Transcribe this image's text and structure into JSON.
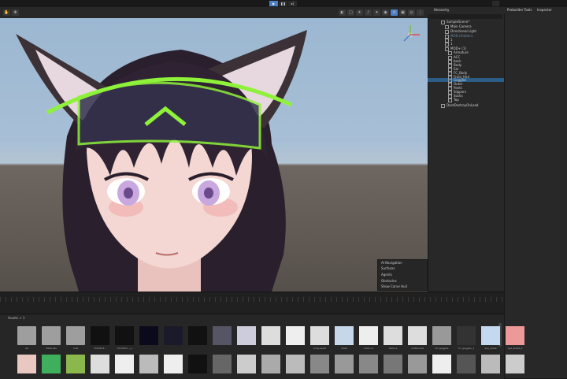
{
  "hierarchy": {
    "tab_label": "Hierarchy",
    "items": [
      {
        "label": "SampleScene*"
      },
      {
        "label": "Main Camera"
      },
      {
        "label": "Directional Light"
      },
      {
        "label": "MOD (Hidden)"
      },
      {
        "label": "1"
      },
      {
        "label": "1"
      },
      {
        "label": "MOD+ (1)"
      },
      {
        "label": "Armature"
      },
      {
        "label": "ACC"
      },
      {
        "label": "back"
      },
      {
        "label": "Body"
      },
      {
        "label": "Ear"
      },
      {
        "label": "FC_Body"
      },
      {
        "label": "Front_Hair"
      },
      {
        "label": "Goggles"
      },
      {
        "label": "Outer"
      },
      {
        "label": "Pants"
      },
      {
        "label": "Slippers"
      },
      {
        "label": "Socks"
      },
      {
        "label": "Top"
      },
      {
        "label": "DontDestroyOnLoad"
      }
    ]
  },
  "inspector": {
    "tabs": [
      "Probuilder Tools",
      "Inspector"
    ]
  },
  "navigation_overlay": {
    "title": "AI Navigation",
    "rows": [
      "Surfaces",
      "Agents",
      "Obstacles",
      "Show Carve Hull"
    ]
  },
  "project": {
    "breadcrumb": "Assets > 1",
    "row1": [
      "all",
      "Materials",
      "mat",
      "7012023...",
      "7012023..._s",
      "",
      "",
      "",
      "",
      "",
      "",
      "",
      "body.asset",
      "mask",
      "mask.uv",
      "texture",
      "uvTextures",
      "for goggles",
      "for goggles_1",
      "eye_sheet",
      "eye_sheet_2"
    ],
    "row2": [
      "",
      "",
      "",
      "",
      "",
      "",
      "",
      "",
      "",
      "",
      "",
      "",
      "",
      "",
      "",
      "",
      "",
      "",
      "",
      "",
      ""
    ]
  },
  "colors": {
    "accent_blue": "#4d7fc2",
    "goggle_green": "#8ef23a",
    "selection": "#2c5d87"
  }
}
